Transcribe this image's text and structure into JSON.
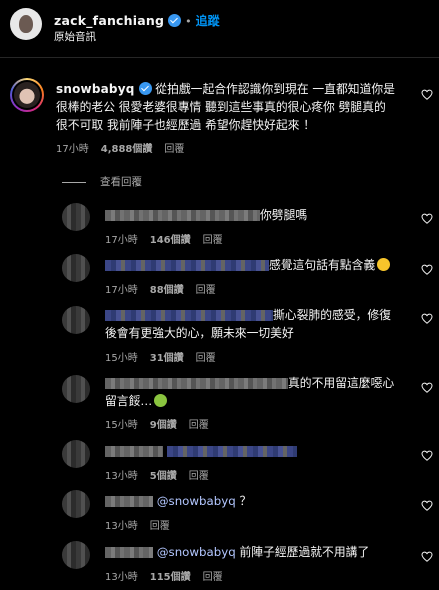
{
  "header": {
    "username": "zack_fanchiang",
    "follow_label": "追蹤",
    "audio_label": "原始音訊"
  },
  "main_comment": {
    "username": "snowbabyq",
    "text_line1": "從拍戲一起合作認識你到現在 一直都知道你是",
    "text_line2": "很棒的老公 很愛老婆很專情 聽到這些事真的很心疼你 劈腿真的",
    "text_line3": "很不可取 我前陣子也經歷過 希望你趕快好起來 ！",
    "time": "17小時",
    "likes": "4,888個讚",
    "reply_label": "回覆",
    "view_replies": "查看回覆"
  },
  "replies": [
    {
      "text": "你劈腿嗎",
      "time": "17小時",
      "likes": "146個讚",
      "reply_label": "回覆",
      "emoji": ""
    },
    {
      "text": "感覺這句話有點含義",
      "time": "17小時",
      "likes": "88個讚",
      "reply_label": "回覆",
      "emoji": "thinking-face"
    },
    {
      "text_line1": "撕心裂肺的感受，修復",
      "text_line2": "後會有更強大的心，願未來一切美好",
      "time": "15小時",
      "likes": "31個讚",
      "reply_label": "回覆"
    },
    {
      "text_line1": "真的不用留這麼噁心",
      "text_line2": "留言餒…",
      "time": "15小時",
      "likes": "9個讚",
      "reply_label": "回覆",
      "emoji": "nauseated-face"
    },
    {
      "time": "13小時",
      "likes": "5個讚",
      "reply_label": "回覆"
    },
    {
      "mention": "@snowbabyq",
      "text": "？",
      "time": "13小時",
      "reply_label": "回覆"
    },
    {
      "mention": "@snowbabyq",
      "text": "前陣子經歷過就不用講了",
      "time": "13小時",
      "likes": "115個讚",
      "reply_label": "回覆"
    }
  ]
}
